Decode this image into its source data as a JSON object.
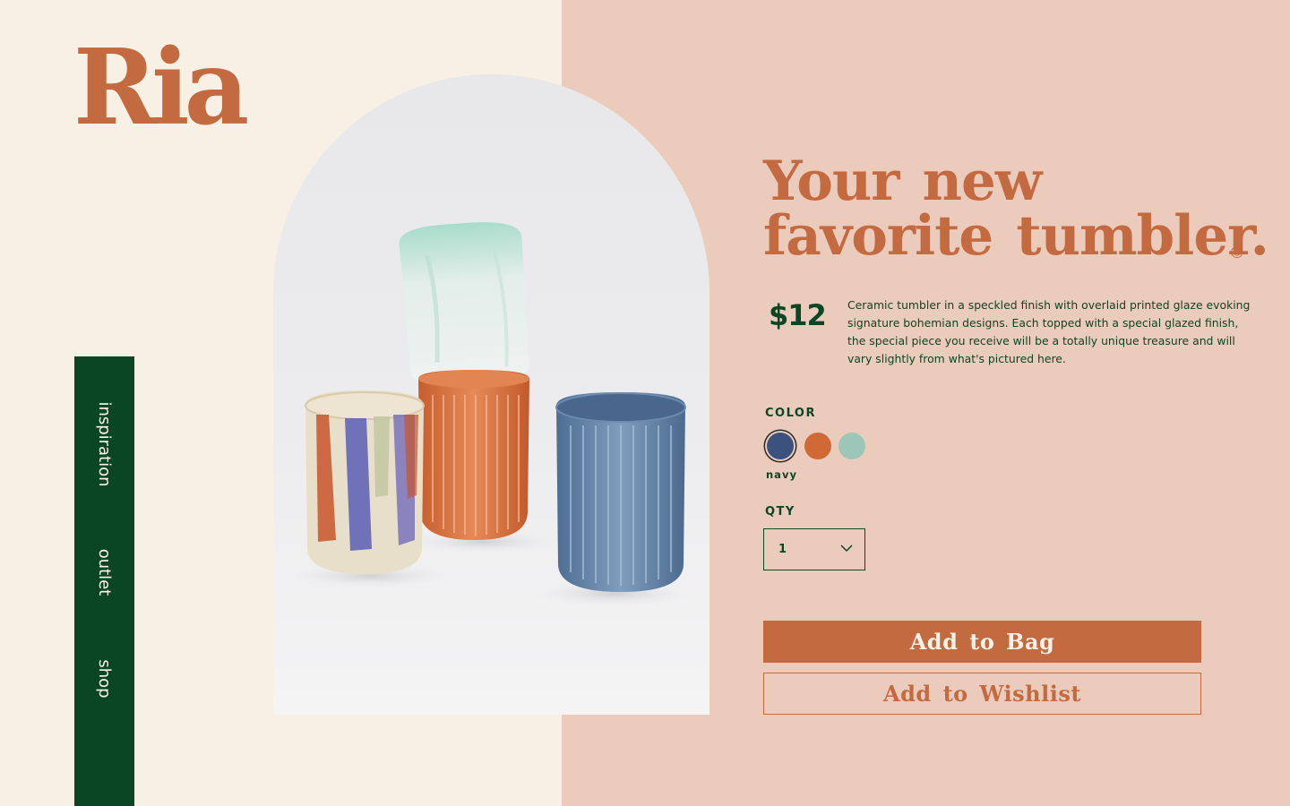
{
  "brand": {
    "logo": "Ria"
  },
  "nav": {
    "items": [
      "inspiration",
      "outlet",
      "shop"
    ]
  },
  "product": {
    "headline_line1": "Your new",
    "headline_line2": "favorite tumbler.",
    "price": "$12",
    "description": "Ceramic tumbler in a speckled finish with overlaid printed glaze evoking signature bohemian designs. Each topped with a special glazed finish, the special piece you receive will be a totally unique treasure and will vary slightly from what's pictured here."
  },
  "options": {
    "color_label": "COLOR",
    "swatches": [
      {
        "name": "navy",
        "hex": "#3b527f"
      },
      {
        "name": "orange",
        "hex": "#cf6a36"
      },
      {
        "name": "mint",
        "hex": "#9cc7b8"
      }
    ],
    "selected_color": "navy",
    "qty_label": "QTY",
    "qty_value": "1"
  },
  "actions": {
    "add_to_bag": "Add to Bag",
    "add_to_wishlist": "Add to Wishlist"
  },
  "colors": {
    "cream": "#f8f0e5",
    "blush": "#ebcbbb",
    "terracotta": "#c46a40",
    "forest_green": "#0b4624"
  }
}
